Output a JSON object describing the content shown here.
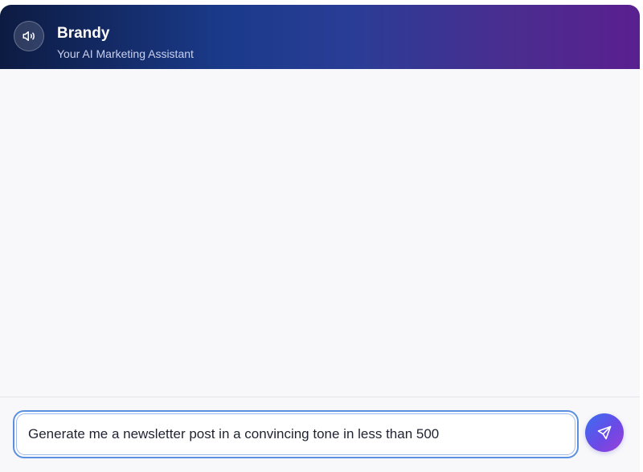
{
  "header": {
    "title": "Brandy",
    "subtitle": "Your AI Marketing Assistant",
    "speaker_icon": "speaker-icon"
  },
  "chat": {
    "messages": []
  },
  "composer": {
    "input_value": "Generate me a newsletter post in a convincing tone in less than 500",
    "send_icon": "send-icon"
  },
  "colors": {
    "header_start": "#0d1b42",
    "header_end": "#5a1f8f",
    "accent_blue": "#3a6ff0",
    "accent_purple": "#9b3fd8",
    "chat_background": "#f8f8fb",
    "input_border": "#5b8fe0"
  }
}
